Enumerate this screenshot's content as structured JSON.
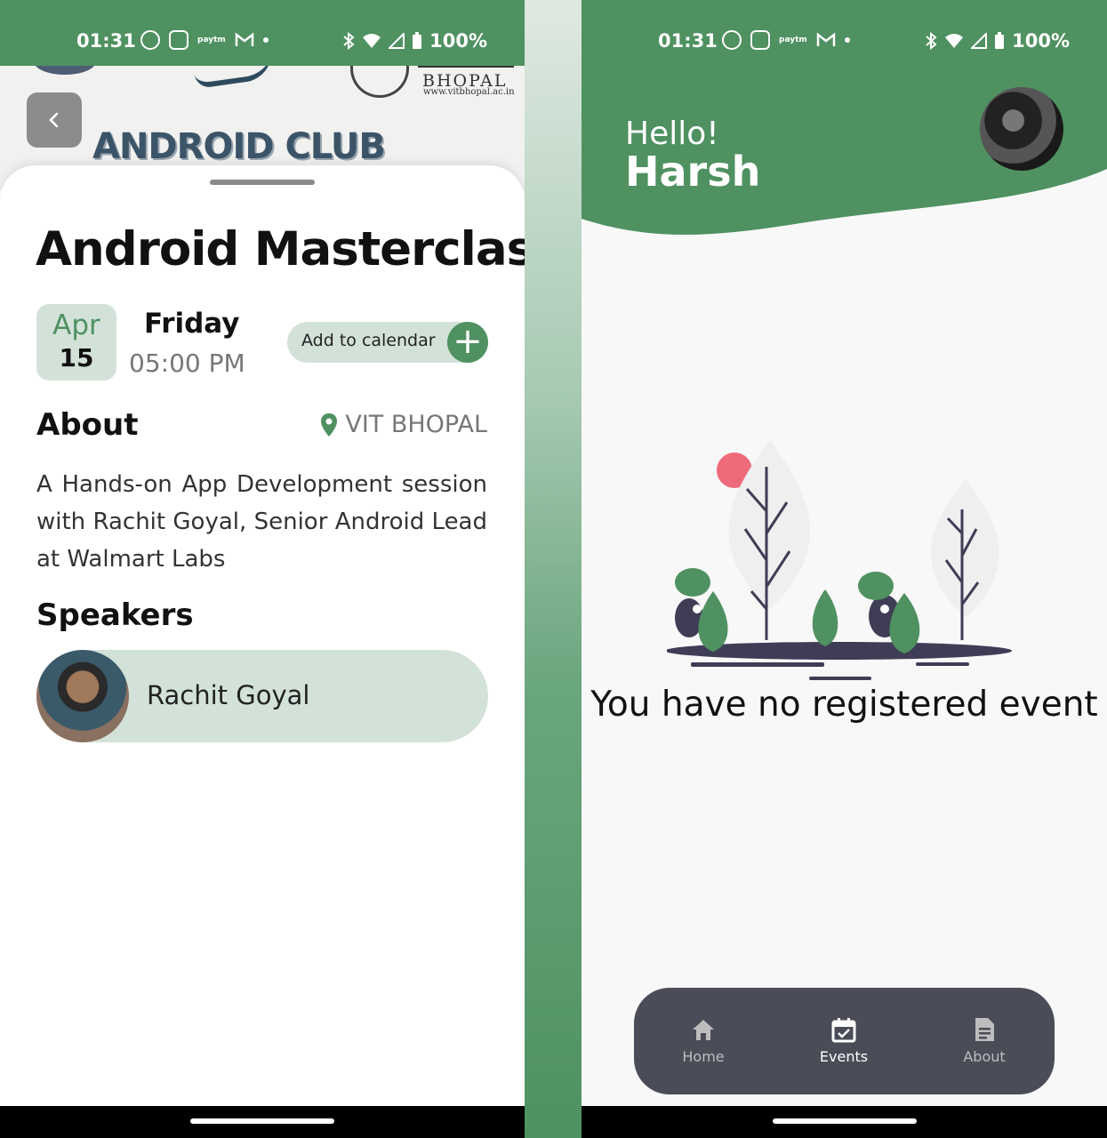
{
  "left": {
    "status": {
      "time": "01:31",
      "battery": "100%",
      "app_text": "paytm"
    },
    "banner": {
      "institution": "BHOPAL",
      "url": "www.vitbhopal.ac.in",
      "club": "ANDROID CLUB"
    },
    "event": {
      "title": "Android Masterclass",
      "month": "Apr",
      "day": "15",
      "weekday": "Friday",
      "time": "05:00 PM",
      "add_calendar": "Add to calendar",
      "about_heading": "About",
      "location": "VIT BHOPAL",
      "description": "A Hands-on App Development session with Rachit Goyal, Senior Android Lead at Walmart Labs",
      "speakers_heading": "Speakers",
      "speakers": [
        {
          "name": "Rachit Goyal"
        }
      ]
    }
  },
  "right": {
    "status": {
      "time": "01:31",
      "battery": "100%",
      "app_text": "paytm"
    },
    "greeting": "Hello!",
    "user_name": "Harsh",
    "empty_message": "You have no registered event",
    "nav": [
      {
        "label": "Home",
        "icon": "home-icon",
        "active": false
      },
      {
        "label": "Events",
        "icon": "calendar-check-icon",
        "active": true
      },
      {
        "label": "About",
        "icon": "document-icon",
        "active": false
      }
    ]
  },
  "colors": {
    "primary": "#4f9161",
    "pill": "#d3e2d9",
    "nav_bg": "#4a4c58",
    "accent_red": "#ee6b7c"
  }
}
